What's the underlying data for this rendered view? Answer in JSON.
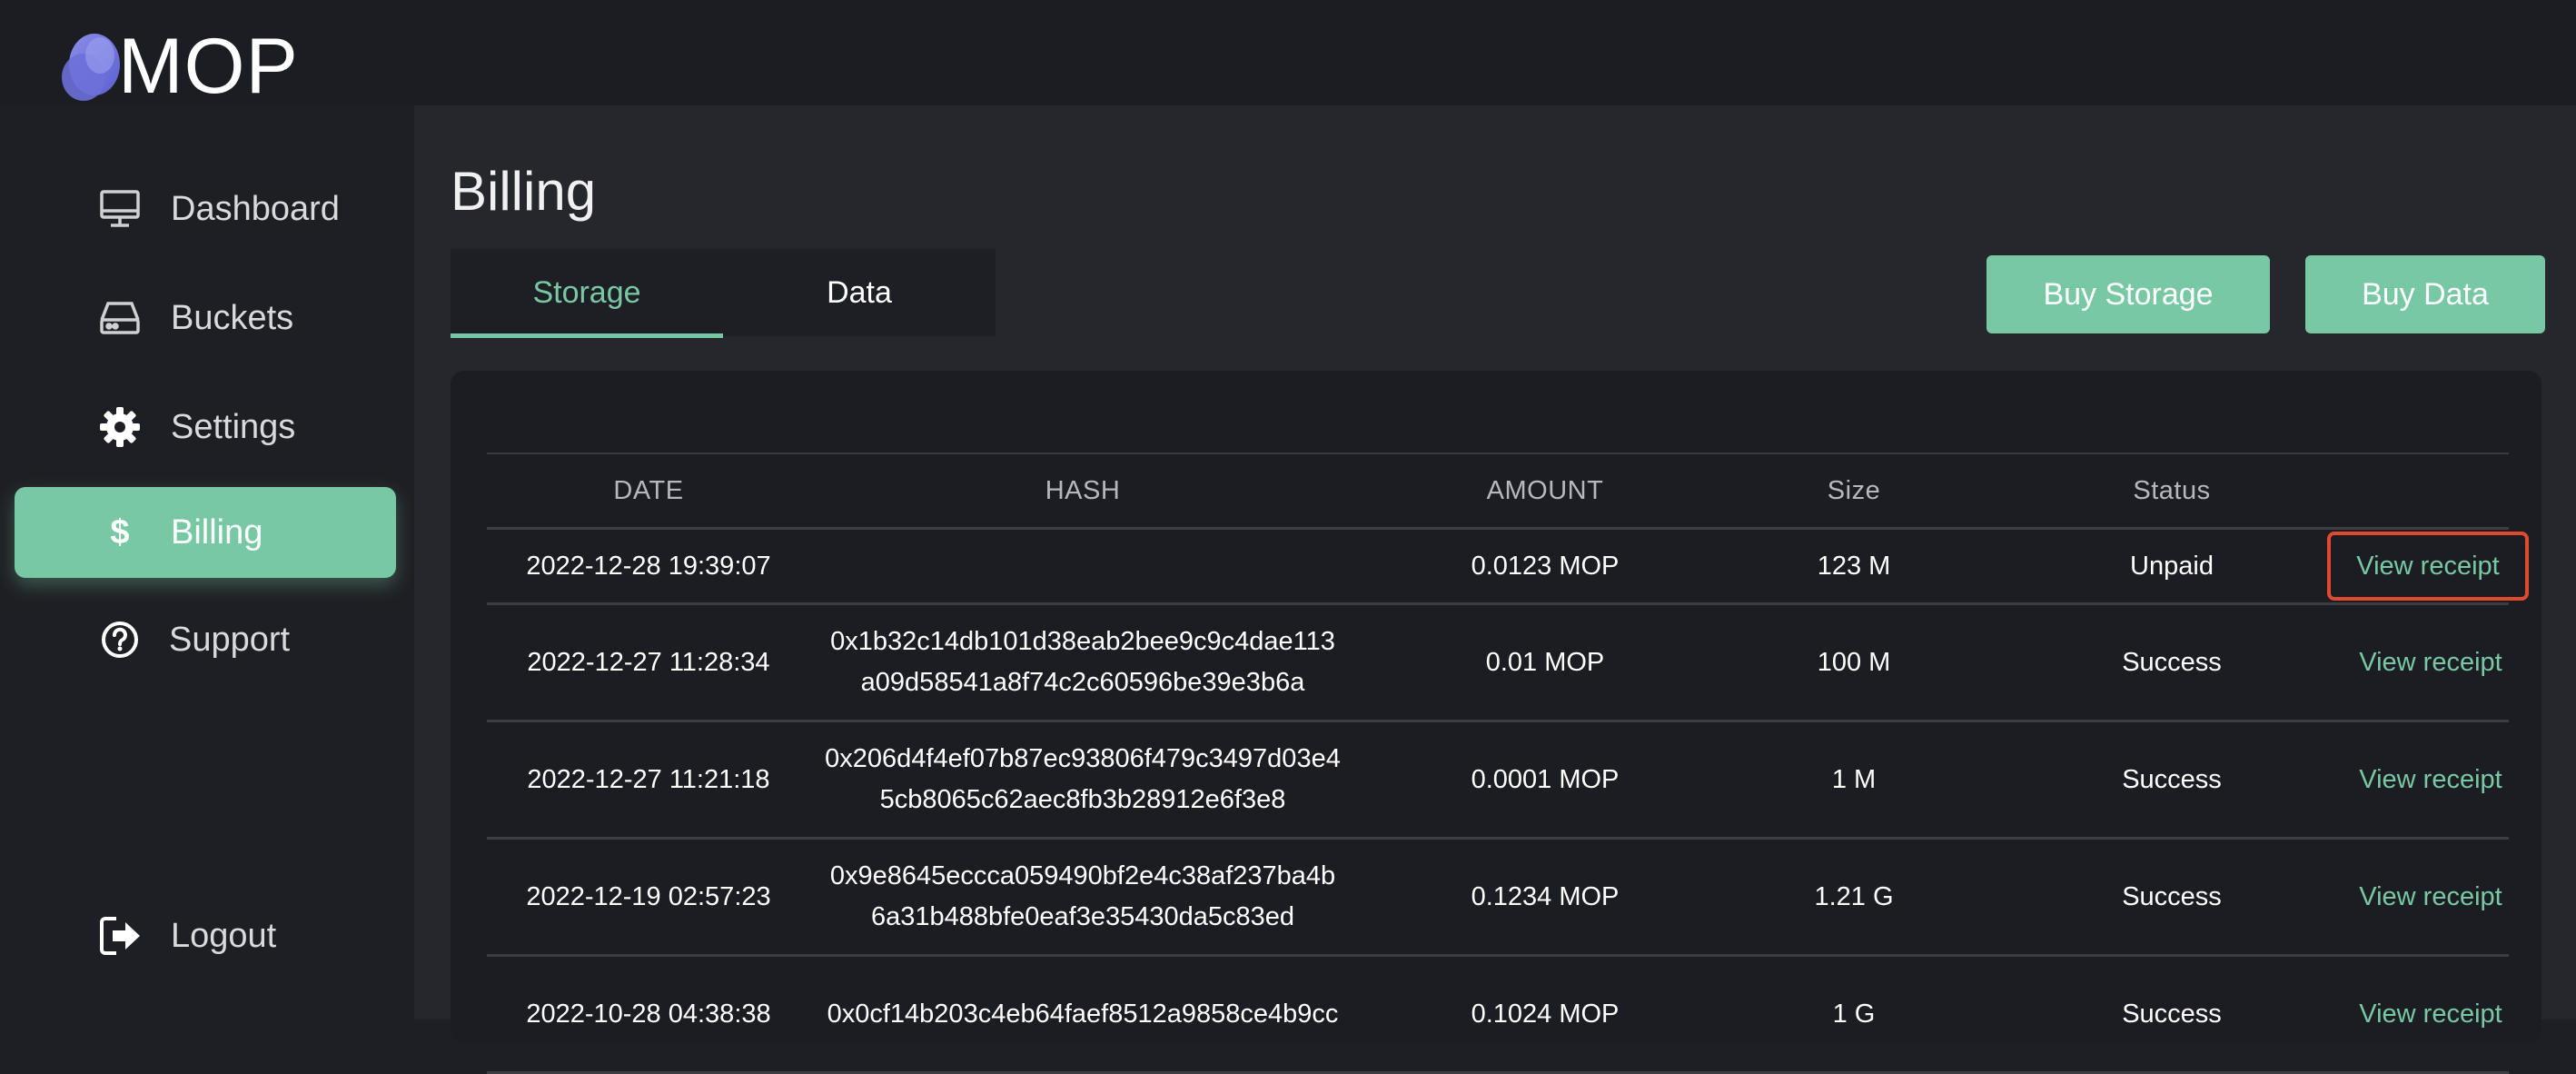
{
  "app": {
    "name": "MOP"
  },
  "sidebar": {
    "items": [
      {
        "label": "Dashboard",
        "icon": "monitor-icon"
      },
      {
        "label": "Buckets",
        "icon": "drive-icon"
      },
      {
        "label": "Settings",
        "icon": "gear-icon"
      },
      {
        "label": "Billing",
        "icon": "dollar-icon",
        "active": true
      },
      {
        "label": "Support",
        "icon": "help-circle-icon"
      }
    ],
    "logout": {
      "label": "Logout",
      "icon": "logout-icon"
    }
  },
  "page": {
    "title": "Billing",
    "tabs": [
      {
        "label": "Storage",
        "active": true
      },
      {
        "label": "Data"
      }
    ],
    "buy_storage_label": "Buy Storage",
    "buy_data_label": "Buy Data"
  },
  "table": {
    "columns": [
      "DATE",
      "HASH",
      "AMOUNT",
      "Size",
      "Status",
      ""
    ],
    "rows": [
      {
        "date": "2022-12-28 19:39:07",
        "hash1": "",
        "hash2": "",
        "amount": "0.0123 MOP",
        "size": "123 M",
        "status": "Unpaid",
        "action": "View receipt"
      },
      {
        "date": "2022-12-27 11:28:34",
        "hash1": "0x1b32c14db101d38eab2bee9c9c4dae113",
        "hash2": "a09d58541a8f74c2c60596be39e3b6a",
        "amount": "0.01 MOP",
        "size": "100 M",
        "status": "Success",
        "action": "View receipt"
      },
      {
        "date": "2022-12-27 11:21:18",
        "hash1": "0x206d4f4ef07b87ec93806f479c3497d03e4",
        "hash2": "5cb8065c62aec8fb3b28912e6f3e8",
        "amount": "0.0001 MOP",
        "size": "1 M",
        "status": "Success",
        "action": "View receipt"
      },
      {
        "date": "2022-12-19 02:57:23",
        "hash1": "0x9e8645eccca059490bf2e4c38af237ba4b",
        "hash2": "6a31b488bfe0eaf3e35430da5c83ed",
        "amount": "0.1234 MOP",
        "size": "1.21 G",
        "status": "Success",
        "action": "View receipt"
      },
      {
        "date": "2022-10-28 04:38:38",
        "hash1": "0x0cf14b203c4eb64faef8512a9858ce4b9cc",
        "hash2": "",
        "amount": "0.1024 MOP",
        "size": "1 G",
        "status": "Success",
        "action": "View receipt"
      }
    ]
  },
  "colors": {
    "accent": "#79c8a4",
    "highlight": "#e04a2f",
    "background": "#1e1f24"
  }
}
